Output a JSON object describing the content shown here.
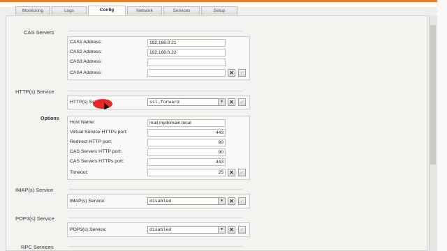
{
  "tabs": [
    {
      "label": "Monitoring",
      "active": false
    },
    {
      "label": "Logs",
      "active": false
    },
    {
      "label": "Config",
      "active": true
    },
    {
      "label": "Network",
      "active": false
    },
    {
      "label": "Services",
      "active": false
    },
    {
      "label": "Setup",
      "active": false
    }
  ],
  "cas_servers": {
    "title": "CAS Servers",
    "fields": [
      {
        "label": "CAS1 Address:",
        "value": "192.168.0.21"
      },
      {
        "label": "CAS2 Address:",
        "value": "192.168.0.22"
      },
      {
        "label": "CAS3 Address:",
        "value": ""
      },
      {
        "label": "CAS4 Address:",
        "value": ""
      }
    ]
  },
  "https_service": {
    "title": "HTTP(s) Service",
    "field_label": "HTTP(s) Service:",
    "selected": "ssl-forward",
    "options_title": "Options",
    "options": [
      {
        "label": "Host Name:",
        "value": "mail.mydomain.local"
      },
      {
        "label": "Virtual Service HTTPs port:",
        "value": "443"
      },
      {
        "label": "Redirect HTTP port:",
        "value": "80"
      },
      {
        "label": "CAS Servers HTTP port:",
        "value": "80"
      },
      {
        "label": "CAS Servers HTTPs port:",
        "value": "443"
      },
      {
        "label": "Timeout:",
        "value": "25"
      }
    ]
  },
  "imap_service": {
    "title": "IMAP(s) Service",
    "field_label": "IMAP(s) Service:",
    "selected": "disabled"
  },
  "pop3_service": {
    "title": "POP3(s) Service",
    "field_label": "POP3(s) Service:",
    "selected": "disabled"
  },
  "rpc_services": {
    "title": "RPC Services"
  },
  "icons": {
    "cancel": "close-icon",
    "apply": "check-icon",
    "dropdown": "chevron-down-icon"
  },
  "colors": {
    "accent_stripe": "#e8832a",
    "cursor_highlight": "#e42020"
  }
}
